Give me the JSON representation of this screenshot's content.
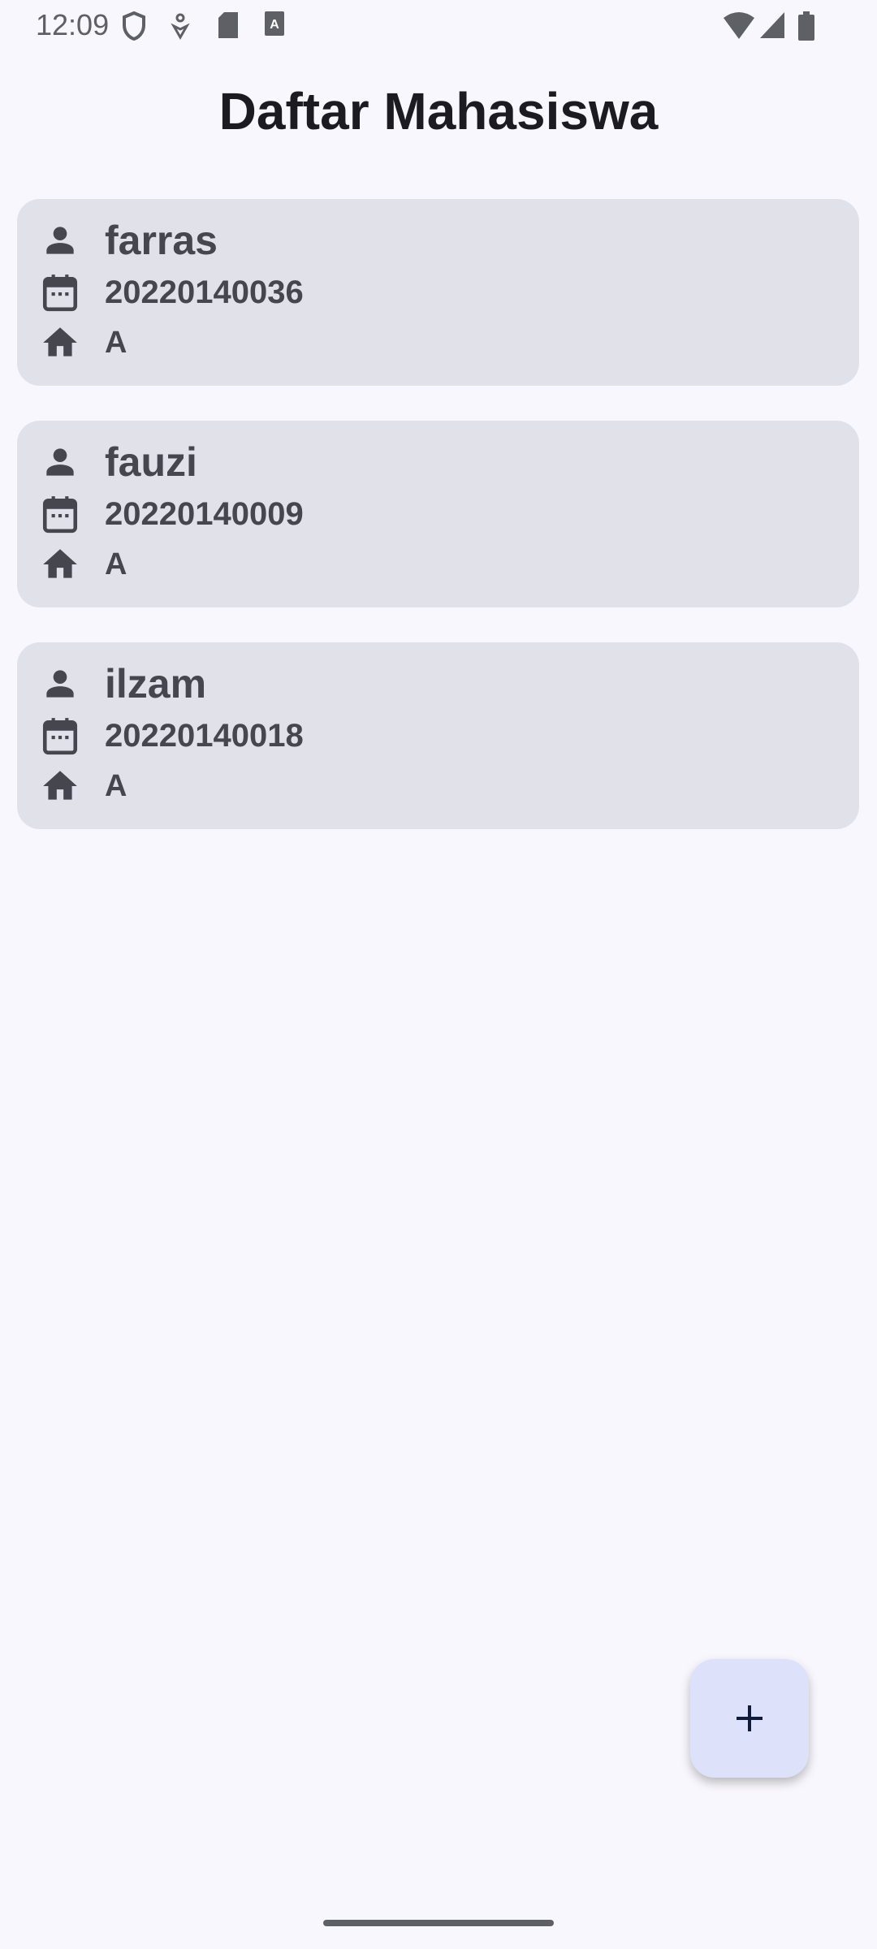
{
  "status_bar": {
    "time": "12:09"
  },
  "header": {
    "title": "Daftar Mahasiswa"
  },
  "students": [
    {
      "name": "farras",
      "nim": "20220140036",
      "kelas": "A"
    },
    {
      "name": "fauzi",
      "nim": "20220140009",
      "kelas": "A"
    },
    {
      "name": "ilzam",
      "nim": "20220140018",
      "kelas": "A"
    }
  ],
  "fab": {
    "icon": "plus-icon"
  },
  "colors": {
    "background": "#f8f7fd",
    "card": "#e1e1ea",
    "fab": "#dde1f9",
    "text": "#46464f"
  }
}
